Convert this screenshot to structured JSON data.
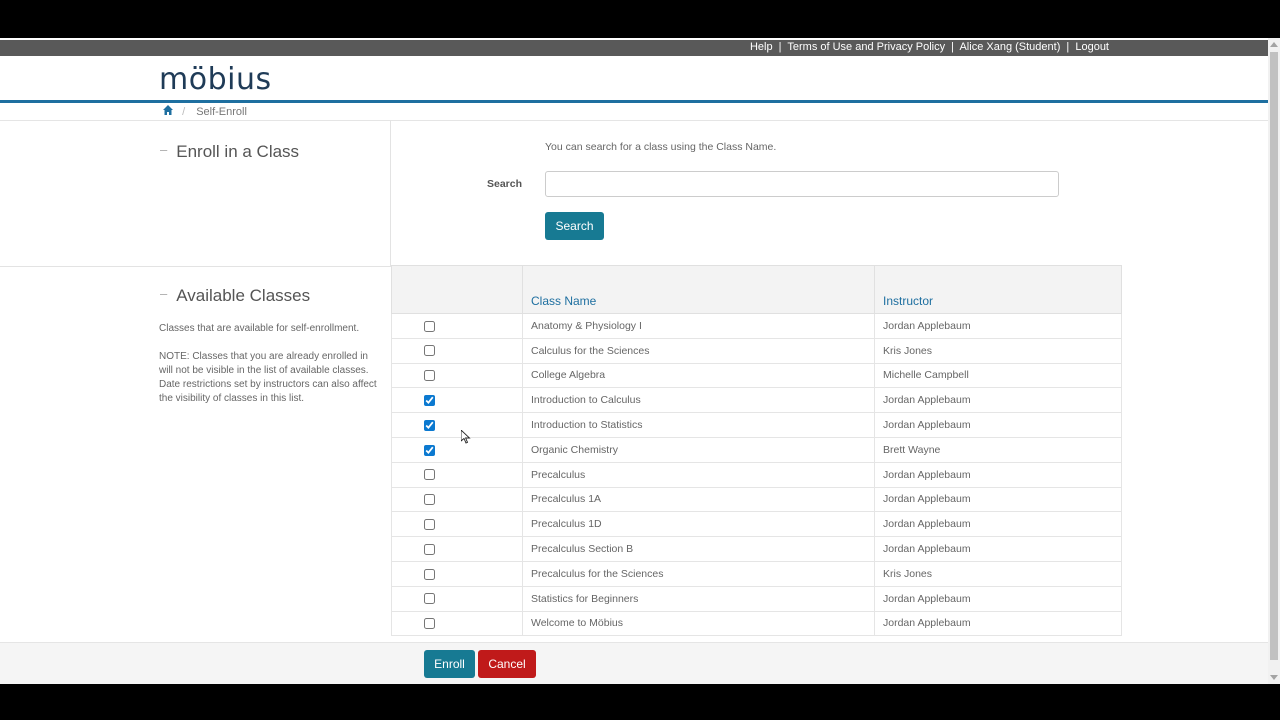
{
  "topbar": {
    "help": "Help",
    "terms": "Terms of Use and Privacy Policy",
    "user": "Alice Xang (Student)",
    "logout": "Logout",
    "separator": "|"
  },
  "logo": {
    "text": "möbius"
  },
  "breadcrumb": {
    "home_icon": "home-icon",
    "current": "Self-Enroll"
  },
  "enroll": {
    "title": "Enroll in a Class",
    "hint": "You can search for a class using the Class Name.",
    "search_label": "Search",
    "search_value": "",
    "search_placeholder": "",
    "search_button": "Search"
  },
  "available": {
    "title": "Available Classes",
    "desc1": "Classes that are available for self-enrollment.",
    "desc2": "NOTE: Classes that you are already enrolled in will not be visible in the list of available classes. Date restrictions set by instructors can also affect the visibility of classes in this list."
  },
  "table": {
    "headers": {
      "class_name": "Class Name",
      "instructor": "Instructor"
    },
    "rows": [
      {
        "name": "Anatomy & Physiology I",
        "instructor": "Jordan Applebaum",
        "checked": false
      },
      {
        "name": "Calculus for the Sciences",
        "instructor": "Kris Jones",
        "checked": false
      },
      {
        "name": "College Algebra",
        "instructor": "Michelle Campbell",
        "checked": false
      },
      {
        "name": "Introduction to Calculus",
        "instructor": "Jordan Applebaum",
        "checked": true
      },
      {
        "name": "Introduction to Statistics",
        "instructor": "Jordan Applebaum",
        "checked": true
      },
      {
        "name": "Organic Chemistry",
        "instructor": "Brett Wayne",
        "checked": true
      },
      {
        "name": "Precalculus",
        "instructor": "Jordan Applebaum",
        "checked": false
      },
      {
        "name": "Precalculus 1A",
        "instructor": "Jordan Applebaum",
        "checked": false
      },
      {
        "name": "Precalculus 1D",
        "instructor": "Jordan Applebaum",
        "checked": false
      },
      {
        "name": "Precalculus Section B",
        "instructor": "Jordan Applebaum",
        "checked": false
      },
      {
        "name": "Precalculus for the Sciences",
        "instructor": "Kris Jones",
        "checked": false
      },
      {
        "name": "Statistics for Beginners",
        "instructor": "Jordan Applebaum",
        "checked": false
      },
      {
        "name": "Welcome to Möbius",
        "instructor": "Jordan Applebaum",
        "checked": false
      }
    ]
  },
  "footer": {
    "enroll": "Enroll",
    "cancel": "Cancel"
  },
  "colors": {
    "accent": "#177a93",
    "danger": "#c01a1a",
    "topbar": "#595959",
    "link": "#1e6fa0"
  }
}
